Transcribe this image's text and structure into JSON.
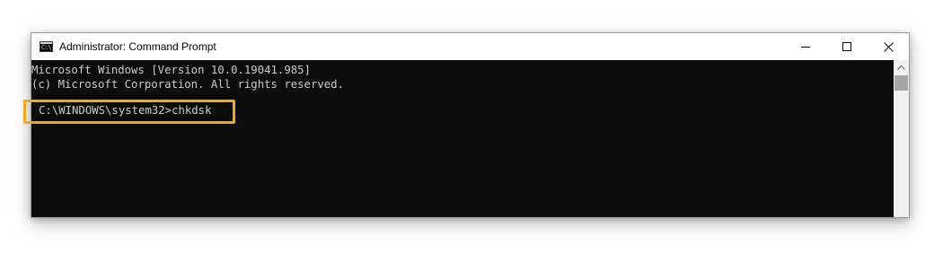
{
  "window": {
    "title": "Administrator: Command Prompt",
    "icon": "cmd-icon",
    "icon_text": "C:\\",
    "controls": {
      "minimize": "minimize-icon",
      "maximize": "maximize-icon",
      "close": "close-icon"
    }
  },
  "console": {
    "lines": [
      "Microsoft Windows [Version 10.0.19041.985]",
      "(c) Microsoft Corporation. All rights reserved."
    ],
    "prompt_command": "C:\\WINDOWS\\system32>chkdsk"
  },
  "colors": {
    "console_background": "#0c0c0c",
    "console_text": "#cccccc",
    "highlight": "#f5a817",
    "titlebar": "#ffffff"
  }
}
